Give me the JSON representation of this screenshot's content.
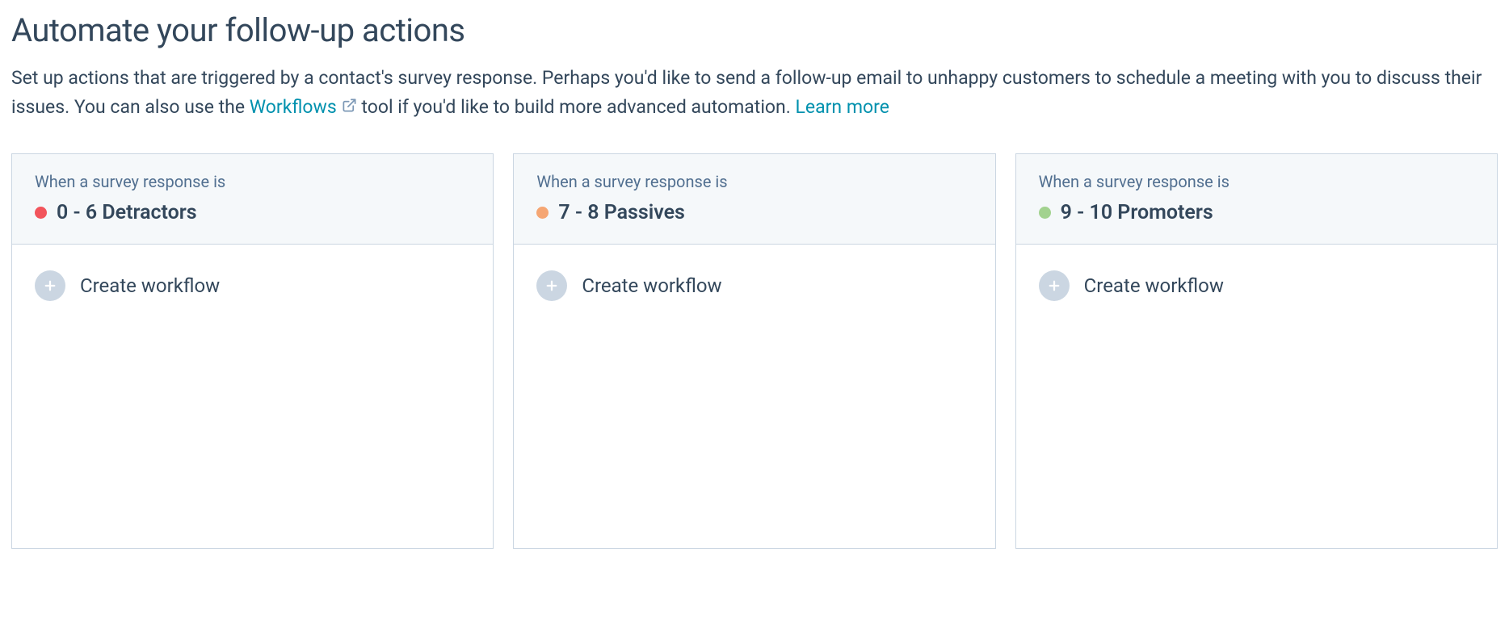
{
  "header": {
    "title": "Automate your follow-up actions",
    "description_part1": "Set up actions that are triggered by a contact's survey response. Perhaps you'd like to send a follow-up email to unhappy customers to schedule a meeting with you to discuss their issues. You can also use the ",
    "workflows_link": "Workflows",
    "description_part2": " tool if you'd like to build more advanced automation. ",
    "learn_more_link": "Learn more"
  },
  "cards": [
    {
      "subtitle": "When a survey response is",
      "title": "0 - 6 Detractors",
      "dot_color": "#f2545b",
      "action_label": "Create workflow"
    },
    {
      "subtitle": "When a survey response is",
      "title": "7 - 8 Passives",
      "dot_color": "#f5a673",
      "action_label": "Create workflow"
    },
    {
      "subtitle": "When a survey response is",
      "title": "9 - 10 Promoters",
      "dot_color": "#a2d28f",
      "action_label": "Create workflow"
    }
  ]
}
